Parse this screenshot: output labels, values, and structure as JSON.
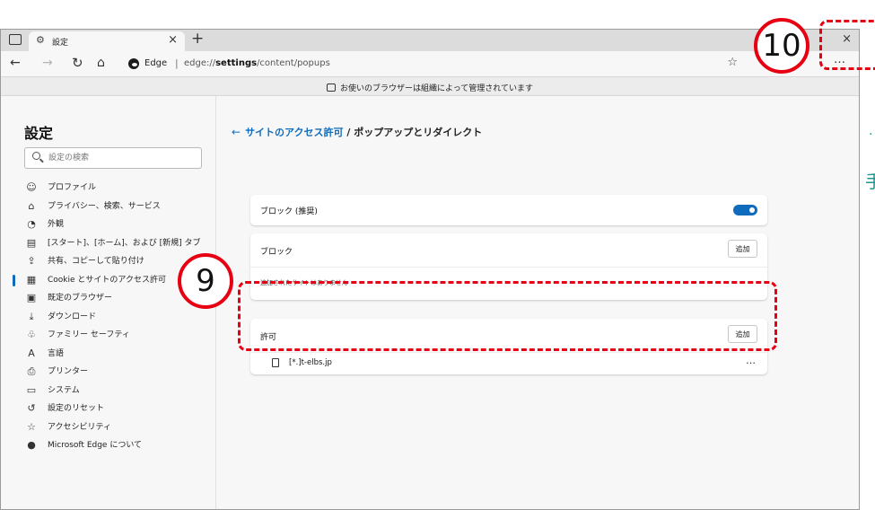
{
  "browser": {
    "tab_title": "設定",
    "new_tab": "+",
    "tab_close": "×",
    "window_close": "×",
    "address_label": "Edge",
    "address_separator": "|",
    "url_prefix": "edge://",
    "url_bold": "settings",
    "url_suffix": "/content/popups",
    "more_menu": "…",
    "banner_text": "お使いのブラウザーは組織によって管理されています"
  },
  "sidebar": {
    "title": "設定",
    "search_placeholder": "設定の検索",
    "items": [
      {
        "icon": "☺",
        "label": "プロファイル"
      },
      {
        "icon": "⌂",
        "label": "プライバシー、検索、サービス"
      },
      {
        "icon": "◔",
        "label": "外観"
      },
      {
        "icon": "▤",
        "label": "[スタート]、[ホーム]、および [新規] タブ"
      },
      {
        "icon": "⇪",
        "label": "共有、コピーして貼り付け"
      },
      {
        "icon": "▦",
        "label": "Cookie とサイトのアクセス許可"
      },
      {
        "icon": "▣",
        "label": "既定のブラウザー"
      },
      {
        "icon": "⤓",
        "label": "ダウンロード"
      },
      {
        "icon": "♧",
        "label": "ファミリー セーフティ"
      },
      {
        "icon": "A",
        "label": "言語"
      },
      {
        "icon": "⎙",
        "label": "プリンター"
      },
      {
        "icon": "▭",
        "label": "システム"
      },
      {
        "icon": "↺",
        "label": "設定のリセット"
      },
      {
        "icon": "☆",
        "label": "アクセシビリティ"
      },
      {
        "icon": "●",
        "label": "Microsoft Edge について"
      }
    ],
    "active_index": 5
  },
  "main": {
    "breadcrumb_back": "←",
    "breadcrumb_link": "サイトのアクセス許可",
    "breadcrumb_current": " / ポップアップとリダイレクト",
    "block_toggle_label": "ブロック (推奨)",
    "block_toggle_on": true,
    "block_section": {
      "title": "ブロック",
      "add_label": "追加",
      "empty_message": "追加されたサイトはありません"
    },
    "allow_section": {
      "title": "許可",
      "add_label": "追加",
      "sites": [
        "[*.]t-elbs.jp"
      ],
      "site_more": "…"
    }
  },
  "annotations": {
    "callout_9": "9",
    "callout_10": "10",
    "accent_color": "#e60012",
    "edge_text_char": "手",
    "edge_text_dot": "·"
  }
}
